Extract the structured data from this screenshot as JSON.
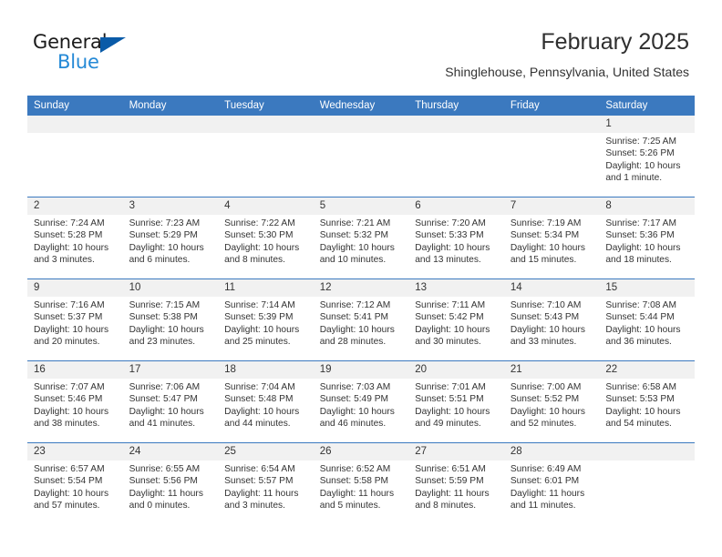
{
  "brand": {
    "word_one": "General",
    "word_two": "Blue",
    "triangle_color": "#0a5ba8",
    "blue_color": "#2489d6"
  },
  "header": {
    "title": "February 2025",
    "subtitle": "Shinglehouse, Pennsylvania, United States",
    "accent_color": "#3b79bf"
  },
  "calendar": {
    "weekday_headers": [
      "Sunday",
      "Monday",
      "Tuesday",
      "Wednesday",
      "Thursday",
      "Friday",
      "Saturday"
    ],
    "weeks": [
      [
        {
          "day": "",
          "sunrise": "",
          "sunset": "",
          "daylight": "",
          "empty": true
        },
        {
          "day": "",
          "sunrise": "",
          "sunset": "",
          "daylight": "",
          "empty": true
        },
        {
          "day": "",
          "sunrise": "",
          "sunset": "",
          "daylight": "",
          "empty": true
        },
        {
          "day": "",
          "sunrise": "",
          "sunset": "",
          "daylight": "",
          "empty": true
        },
        {
          "day": "",
          "sunrise": "",
          "sunset": "",
          "daylight": "",
          "empty": true
        },
        {
          "day": "",
          "sunrise": "",
          "sunset": "",
          "daylight": "",
          "empty": true
        },
        {
          "day": "1",
          "sunrise": "Sunrise: 7:25 AM",
          "sunset": "Sunset: 5:26 PM",
          "daylight": "Daylight: 10 hours and 1 minute."
        }
      ],
      [
        {
          "day": "2",
          "sunrise": "Sunrise: 7:24 AM",
          "sunset": "Sunset: 5:28 PM",
          "daylight": "Daylight: 10 hours and 3 minutes."
        },
        {
          "day": "3",
          "sunrise": "Sunrise: 7:23 AM",
          "sunset": "Sunset: 5:29 PM",
          "daylight": "Daylight: 10 hours and 6 minutes."
        },
        {
          "day": "4",
          "sunrise": "Sunrise: 7:22 AM",
          "sunset": "Sunset: 5:30 PM",
          "daylight": "Daylight: 10 hours and 8 minutes."
        },
        {
          "day": "5",
          "sunrise": "Sunrise: 7:21 AM",
          "sunset": "Sunset: 5:32 PM",
          "daylight": "Daylight: 10 hours and 10 minutes."
        },
        {
          "day": "6",
          "sunrise": "Sunrise: 7:20 AM",
          "sunset": "Sunset: 5:33 PM",
          "daylight": "Daylight: 10 hours and 13 minutes."
        },
        {
          "day": "7",
          "sunrise": "Sunrise: 7:19 AM",
          "sunset": "Sunset: 5:34 PM",
          "daylight": "Daylight: 10 hours and 15 minutes."
        },
        {
          "day": "8",
          "sunrise": "Sunrise: 7:17 AM",
          "sunset": "Sunset: 5:36 PM",
          "daylight": "Daylight: 10 hours and 18 minutes."
        }
      ],
      [
        {
          "day": "9",
          "sunrise": "Sunrise: 7:16 AM",
          "sunset": "Sunset: 5:37 PM",
          "daylight": "Daylight: 10 hours and 20 minutes."
        },
        {
          "day": "10",
          "sunrise": "Sunrise: 7:15 AM",
          "sunset": "Sunset: 5:38 PM",
          "daylight": "Daylight: 10 hours and 23 minutes."
        },
        {
          "day": "11",
          "sunrise": "Sunrise: 7:14 AM",
          "sunset": "Sunset: 5:39 PM",
          "daylight": "Daylight: 10 hours and 25 minutes."
        },
        {
          "day": "12",
          "sunrise": "Sunrise: 7:12 AM",
          "sunset": "Sunset: 5:41 PM",
          "daylight": "Daylight: 10 hours and 28 minutes."
        },
        {
          "day": "13",
          "sunrise": "Sunrise: 7:11 AM",
          "sunset": "Sunset: 5:42 PM",
          "daylight": "Daylight: 10 hours and 30 minutes."
        },
        {
          "day": "14",
          "sunrise": "Sunrise: 7:10 AM",
          "sunset": "Sunset: 5:43 PM",
          "daylight": "Daylight: 10 hours and 33 minutes."
        },
        {
          "day": "15",
          "sunrise": "Sunrise: 7:08 AM",
          "sunset": "Sunset: 5:44 PM",
          "daylight": "Daylight: 10 hours and 36 minutes."
        }
      ],
      [
        {
          "day": "16",
          "sunrise": "Sunrise: 7:07 AM",
          "sunset": "Sunset: 5:46 PM",
          "daylight": "Daylight: 10 hours and 38 minutes."
        },
        {
          "day": "17",
          "sunrise": "Sunrise: 7:06 AM",
          "sunset": "Sunset: 5:47 PM",
          "daylight": "Daylight: 10 hours and 41 minutes."
        },
        {
          "day": "18",
          "sunrise": "Sunrise: 7:04 AM",
          "sunset": "Sunset: 5:48 PM",
          "daylight": "Daylight: 10 hours and 44 minutes."
        },
        {
          "day": "19",
          "sunrise": "Sunrise: 7:03 AM",
          "sunset": "Sunset: 5:49 PM",
          "daylight": "Daylight: 10 hours and 46 minutes."
        },
        {
          "day": "20",
          "sunrise": "Sunrise: 7:01 AM",
          "sunset": "Sunset: 5:51 PM",
          "daylight": "Daylight: 10 hours and 49 minutes."
        },
        {
          "day": "21",
          "sunrise": "Sunrise: 7:00 AM",
          "sunset": "Sunset: 5:52 PM",
          "daylight": "Daylight: 10 hours and 52 minutes."
        },
        {
          "day": "22",
          "sunrise": "Sunrise: 6:58 AM",
          "sunset": "Sunset: 5:53 PM",
          "daylight": "Daylight: 10 hours and 54 minutes."
        }
      ],
      [
        {
          "day": "23",
          "sunrise": "Sunrise: 6:57 AM",
          "sunset": "Sunset: 5:54 PM",
          "daylight": "Daylight: 10 hours and 57 minutes."
        },
        {
          "day": "24",
          "sunrise": "Sunrise: 6:55 AM",
          "sunset": "Sunset: 5:56 PM",
          "daylight": "Daylight: 11 hours and 0 minutes."
        },
        {
          "day": "25",
          "sunrise": "Sunrise: 6:54 AM",
          "sunset": "Sunset: 5:57 PM",
          "daylight": "Daylight: 11 hours and 3 minutes."
        },
        {
          "day": "26",
          "sunrise": "Sunrise: 6:52 AM",
          "sunset": "Sunset: 5:58 PM",
          "daylight": "Daylight: 11 hours and 5 minutes."
        },
        {
          "day": "27",
          "sunrise": "Sunrise: 6:51 AM",
          "sunset": "Sunset: 5:59 PM",
          "daylight": "Daylight: 11 hours and 8 minutes."
        },
        {
          "day": "28",
          "sunrise": "Sunrise: 6:49 AM",
          "sunset": "Sunset: 6:01 PM",
          "daylight": "Daylight: 11 hours and 11 minutes."
        },
        {
          "day": "",
          "sunrise": "",
          "sunset": "",
          "daylight": "",
          "empty": true
        }
      ]
    ]
  }
}
